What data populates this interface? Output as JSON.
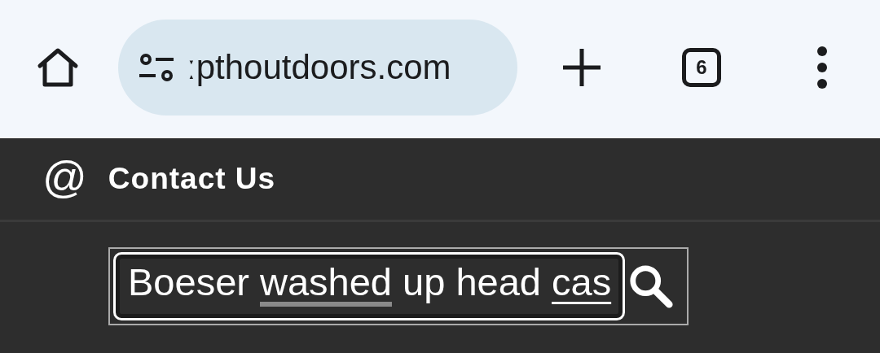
{
  "browser_toolbar": {
    "url": "ːpthoutdoors.com",
    "tab_count": "6"
  },
  "contact_link": {
    "icon_glyph": "@",
    "label": "Contact Us"
  },
  "search": {
    "value_segments": [
      {
        "text": "Boeser ",
        "kind": "plain"
      },
      {
        "text": "washed",
        "kind": "spellcheck"
      },
      {
        "text": " up head ",
        "kind": "plain"
      },
      {
        "text": "cas",
        "kind": "composing"
      }
    ]
  }
}
